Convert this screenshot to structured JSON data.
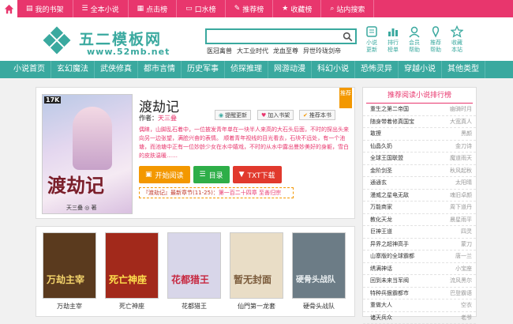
{
  "topbar": {
    "links": [
      {
        "icon": "bookshelf-icon",
        "glyph": "▤",
        "label": "我的书架"
      },
      {
        "icon": "list-icon",
        "glyph": "☰",
        "label": "全本小说"
      },
      {
        "icon": "chart-icon",
        "glyph": "▦",
        "label": "点击榜"
      },
      {
        "icon": "monitor-icon",
        "glyph": "▭",
        "label": "口水榜"
      },
      {
        "icon": "thumbs-icon",
        "glyph": "✎",
        "label": "推荐榜"
      },
      {
        "icon": "star-icon",
        "glyph": "★",
        "label": "收藏榜"
      },
      {
        "icon": "search-icon",
        "glyph": "⌕",
        "label": "站内搜索"
      }
    ]
  },
  "logo": {
    "name": "五二模板网",
    "url": "www.52mb.net"
  },
  "search": {
    "value": "",
    "placeholder": ""
  },
  "hotwords": [
    "医冠禽兽",
    "大工业时代",
    "龙血至尊",
    "异世玲珑剑帝"
  ],
  "quick": [
    {
      "icon": "novel-update-icon",
      "line1": "小说",
      "line2": "更新"
    },
    {
      "icon": "rank-icon",
      "line1": "排行",
      "line2": "榜单"
    },
    {
      "icon": "member-icon",
      "line1": "会员",
      "line2": "帮助"
    },
    {
      "icon": "recommend-icon",
      "line1": "推荐",
      "line2": "帮助"
    },
    {
      "icon": "favorite-icon",
      "line1": "收藏",
      "line2": "本站"
    }
  ],
  "nav": [
    "小说首页",
    "玄幻魔法",
    "武侠修真",
    "都市言情",
    "历史军事",
    "侦探推理",
    "网游动漫",
    "科幻小说",
    "恐怖灵异",
    "穿越小说",
    "其他类型"
  ],
  "book": {
    "title": "渡劫记",
    "author_label": "作者：",
    "author": "天三叠",
    "pills": [
      "提醒更新",
      "加入书架",
      "推荐本书"
    ],
    "tag": "推荐",
    "cover_title": "渡劫记",
    "cover_author": "天三叠 ◎ 著",
    "cover_brand": "17K",
    "description": "偶睐，山脚乱石着中，一位披发青年单在一块半人来高的大石头后面，不时的探出头来向另一边张望，满脸兴奋的表情。 顺着青年视线的目光看去，石块不远处，有一个池塘，而池塘中正有一位妙龄少女在水中嬉戏，不时的从水中露出曼妙美好的身躯，雪白的皮肤温暖……",
    "buttons": [
      "开始阅读",
      "目录",
      "TXT下载"
    ],
    "latest_label": "『渡劫记』最新章节(11-25)：",
    "latest_chapter": "第一百二十四章 至善归宗"
  },
  "recommend": [
    {
      "name": "万劫主宰",
      "cover_text": "万劫主宰",
      "bg": "#5a3a1e"
    },
    {
      "name": "死亡神座",
      "cover_text": "死亡神座",
      "bg": "#a2291b"
    },
    {
      "name": "花都猎王",
      "cover_text": "花都猎王",
      "bg": "#d8d6e9"
    },
    {
      "name": "仙門第一龙套",
      "cover_text": "暂无封面",
      "bg": "#e9ddc6"
    },
    {
      "name": "硬骨头战队",
      "cover_text": "硬骨头战队",
      "bg": "#6c7c86"
    }
  ],
  "rank": {
    "title": "推荐阅读小说排行榜",
    "rows": [
      {
        "title": "重生之第二帝国",
        "author": "幽骑时月"
      },
      {
        "title": "随身带着修真国宝",
        "author": "大宽真人"
      },
      {
        "title": "敢撩",
        "author": "黑颜"
      },
      {
        "title": "仙晶久奶",
        "author": "金刀诗"
      },
      {
        "title": "全球王国联盟",
        "author": "魔道雨天"
      },
      {
        "title": "金阶剑圣",
        "author": "秋风起秋"
      },
      {
        "title": "通通玄",
        "author": "太阳晴"
      },
      {
        "title": "漫威之星电无敌",
        "author": "魂旧卓颜"
      },
      {
        "title": "万能商家",
        "author": "周下道丹"
      },
      {
        "title": "教化天龙",
        "author": "晨星雨平"
      },
      {
        "title": "巨神王道",
        "author": "四灵"
      },
      {
        "title": "异界之超神高手",
        "author": "蒙刀"
      },
      {
        "title": "山寨版的全球霸都",
        "author": "唐一兰"
      },
      {
        "title": "绣满神话",
        "author": "小宝座"
      },
      {
        "title": "回到未来当军阀",
        "author": "流风黑尔"
      },
      {
        "title": "特种兵狠霸都市",
        "author": "巴登霸语"
      },
      {
        "title": "重做大人",
        "author": "空衣"
      },
      {
        "title": "诸天兵众",
        "author": "老爷"
      }
    ]
  },
  "colors": {
    "pink": "#e8366d",
    "teal": "#3aa99f",
    "orange": "#f39800",
    "green": "#2eae48",
    "red": "#e1392d"
  }
}
